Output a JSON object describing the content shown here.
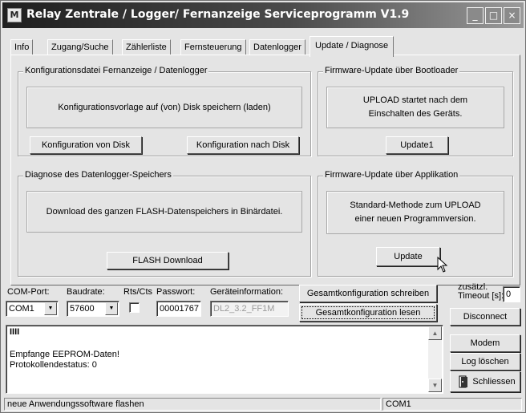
{
  "window": {
    "title": "Relay Zentrale / Logger/ Fernanzeige Serviceprogramm  V1.9",
    "app_icon_glyph": "M",
    "controls": {
      "minimize": "_",
      "maximize": "□",
      "close": "×"
    }
  },
  "tabs": [
    {
      "label": "Info",
      "active": false
    },
    {
      "label": "Zugang/Suche",
      "active": false
    },
    {
      "label": "Zählerliste",
      "active": false
    },
    {
      "label": "Fernsteuerung",
      "active": false
    },
    {
      "label": "Datenlogger",
      "active": false
    },
    {
      "label": "Update / Diagnose",
      "active": true
    }
  ],
  "panel": {
    "config": {
      "title": "Konfigurationsdatei Fernanzeige / Datenlogger",
      "text": "Konfigurationsvorlage auf (von) Disk speichern (laden)",
      "btn_from_disk": "Konfiguration von Disk",
      "btn_to_disk": "Konfiguration nach Disk"
    },
    "bootloader": {
      "title": "Firmware-Update über Bootloader",
      "text_1": "UPLOAD startet nach dem",
      "text_2": "Einschalten des Geräts.",
      "btn": "Update1"
    },
    "diagnose": {
      "title": "Diagnose des Datenlogger-Speichers",
      "text": "Download des ganzen FLASH-Datenspeichers in Binärdatei.",
      "btn": "FLASH Download"
    },
    "application": {
      "title": "Firmware-Update über Applikation",
      "text_1": "Standard-Methode zum UPLOAD",
      "text_2": "einer neuen Programmversion.",
      "btn": "Update"
    }
  },
  "bottom": {
    "com_port_label": "COM-Port:",
    "com_port_value": "COM1",
    "baud_label": "Baudrate:",
    "baud_value": "57600",
    "rtscts_label": "Rts/Cts",
    "rtscts_checked": false,
    "password_label": "Passwort:",
    "password_value": "00001767",
    "devinfo_label": "Geräteinformation:",
    "devinfo_value": "DL2_3.2_FF1M",
    "btn_write_config": "Gesamtkonfiguration schreiben",
    "btn_read_config": "Gesamtkonfiguration lesen",
    "timeout_label_1": "zusätzl.",
    "timeout_label_2": "Timeout [s]:",
    "timeout_value": "0",
    "btn_disconnect": "Disconnect",
    "btn_modem": "Modem",
    "btn_clear_log": "Log löschen",
    "btn_close": "Schliessen"
  },
  "log": {
    "line_1": "IIII",
    "line_2": "Empfange EEPROM-Daten!",
    "line_3": "Protokollendestatus: 0"
  },
  "status": {
    "message": "neue Anwendungssoftware flashen",
    "port": "COM1"
  }
}
